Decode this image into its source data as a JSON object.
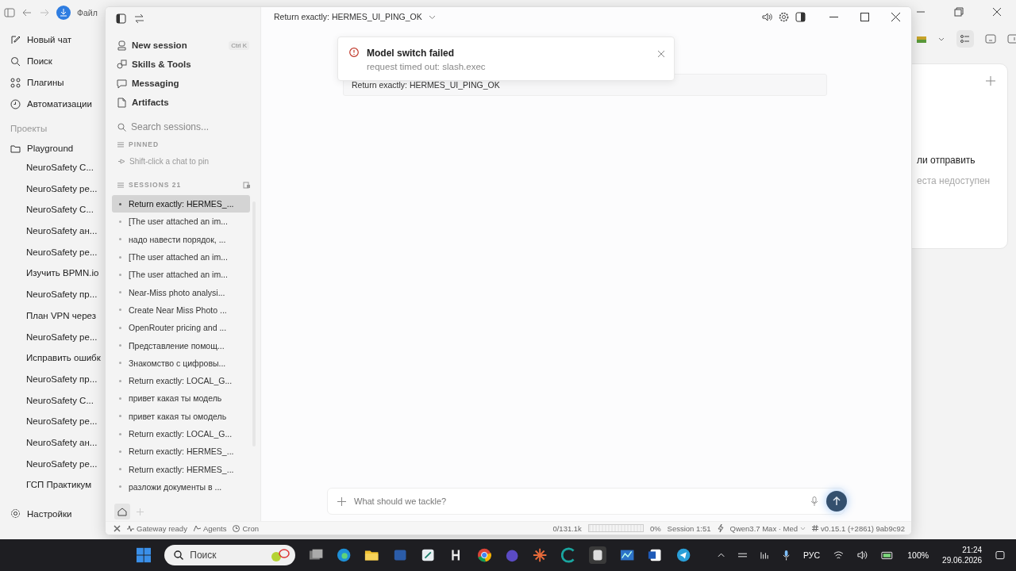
{
  "background_app": {
    "menu_label": "Файл",
    "nav": [
      {
        "kind": "new",
        "label": "Новый чат"
      },
      {
        "kind": "search",
        "label": "Поиск"
      },
      {
        "kind": "plugins",
        "label": "Плагины"
      },
      {
        "kind": "auto",
        "label": "Автоматизации"
      }
    ],
    "projects_label": "Проекты",
    "project": "Playground",
    "chats": [
      "NeuroSafety C...",
      "NeuroSafety pe...",
      "NeuroSafety C...",
      "NeuroSafety ан...",
      "NeuroSafety pe...",
      "Изучить BPMN.io",
      "NeuroSafety пр...",
      "План VPN через",
      "NeuroSafety pe...",
      "Исправить ошибк",
      "NeuroSafety пр...",
      "NeuroSafety C...",
      "NeuroSafety pe...",
      "NeuroSafety ан...",
      "NeuroSafety pe...",
      "ГСП Практикум"
    ],
    "settings": "Настройки",
    "panel_line_1": "ли отправить",
    "panel_line_2": "еста недоступен"
  },
  "window": {
    "title": "Return exactly: HERMES_UI_PING_OK",
    "sidebar": {
      "nav": [
        {
          "kind": "session",
          "label": "New session"
        },
        {
          "kind": "skills",
          "label": "Skills & Tools"
        },
        {
          "kind": "messaging",
          "label": "Messaging"
        },
        {
          "kind": "artifacts",
          "label": "Artifacts"
        }
      ],
      "shortcut": [
        "Ctrl",
        "K"
      ],
      "search": {
        "placeholder": "Search sessions..."
      },
      "pinned_label": "PINNED",
      "pinned_hint": "Shift-click a chat to pin",
      "sessions_label": "SESSIONS 21",
      "sessions": [
        {
          "title": "Return exactly: HERMES_...",
          "selected": true
        },
        {
          "title": "[The user attached an im...",
          "selected": false
        },
        {
          "title": "надо навести порядок, ...",
          "selected": false
        },
        {
          "title": "[The user attached an im...",
          "selected": false
        },
        {
          "title": "[The user attached an im...",
          "selected": false
        },
        {
          "title": "Near-Miss photo analysi...",
          "selected": false
        },
        {
          "title": "Create Near Miss Photo ...",
          "selected": false
        },
        {
          "title": "OpenRouter pricing and ...",
          "selected": false
        },
        {
          "title": "Представление помощ...",
          "selected": false
        },
        {
          "title": "Знакомство с цифровы...",
          "selected": false
        },
        {
          "title": "Return exactly: LOCAL_G...",
          "selected": false
        },
        {
          "title": "привет какая ты модель",
          "selected": false
        },
        {
          "title": "привет какая ты омодель",
          "selected": false
        },
        {
          "title": "Return exactly: LOCAL_G...",
          "selected": false
        },
        {
          "title": "Return exactly: HERMES_...",
          "selected": false
        },
        {
          "title": "Return exactly: HERMES_...",
          "selected": false
        },
        {
          "title": "разложи документы в ...",
          "selected": false
        }
      ]
    },
    "toast": {
      "title": "Model switch failed",
      "message": "request timed out: slash.exec"
    },
    "message": "Return exactly: HERMES_UI_PING_OK",
    "composer": {
      "placeholder": "What should we tackle?"
    },
    "status_bar": {
      "gateway": "Gateway ready",
      "agents": "Agents",
      "cron": "Cron",
      "tokens": "0/131.1k",
      "context": {
        "level": 0
      },
      "percent": "0%",
      "session": "Session 1:51",
      "model": "Qwen3.7 Max · Med",
      "version": "v0.15.1 (+2861) 9ab9c92"
    }
  },
  "taskbar": {
    "search": {
      "placeholder": "Поиск"
    },
    "language": "РУС",
    "battery": "100%",
    "time": "21:24",
    "date": "29.06.2026"
  }
}
